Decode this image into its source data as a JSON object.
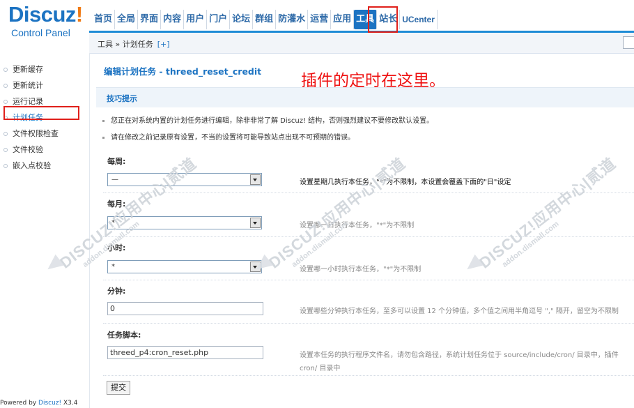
{
  "logo": {
    "brand": "Discuz",
    "bang": "!",
    "sub": "Control Panel"
  },
  "topnav": [
    {
      "label": "首页",
      "active": false
    },
    {
      "label": "全局",
      "active": false
    },
    {
      "label": "界面",
      "active": false
    },
    {
      "label": "内容",
      "active": false
    },
    {
      "label": "用户",
      "active": false
    },
    {
      "label": "门户",
      "active": false
    },
    {
      "label": "论坛",
      "active": false
    },
    {
      "label": "群组",
      "active": false
    },
    {
      "label": "防灌水",
      "active": false
    },
    {
      "label": "运营",
      "active": false
    },
    {
      "label": "应用",
      "active": false
    },
    {
      "label": "工具",
      "active": true
    },
    {
      "label": "站长",
      "active": false
    },
    {
      "label": "UCenter",
      "active": false
    }
  ],
  "breadcrumb": {
    "text": "工具 » 计划任务",
    "add": "[+]"
  },
  "sidebar": {
    "items": [
      "更新缓存",
      "更新统计",
      "运行记录",
      "计划任务",
      "文件权限检查",
      "文件校验",
      "嵌入点校验"
    ],
    "active_index": 3
  },
  "powered": {
    "prefix": "Powered by ",
    "link": "Discuz!",
    "version": " X3.4"
  },
  "page_title": "编辑计划任务 - threed_reset_credit",
  "annotation": "插件的定时在这里。",
  "tips": {
    "heading": "技巧提示",
    "lines": [
      "您正在对系统内置的计划任务进行编辑，除非非常了解 Discuz! 结构，否则强烈建议不要修改默认设置。",
      "请在修改之前记录原有设置，不当的设置将可能导致站点出现不可预期的错误。"
    ]
  },
  "form": {
    "weekly": {
      "label": "每周:",
      "value": "—",
      "desc": "设置星期几执行本任务，\"*\"为不限制，本设置会覆盖下面的\"日\"设定"
    },
    "monthly": {
      "label": "每月:",
      "value": "*",
      "desc": "设置哪一日执行本任务，\"*\"为不限制"
    },
    "hour": {
      "label": "小时:",
      "value": "*",
      "desc": "设置哪一小时执行本任务，\"*\"为不限制"
    },
    "minute": {
      "label": "分钟:",
      "value": "0",
      "desc": "设置哪些分钟执行本任务，至多可以设置 12 个分钟值，多个值之间用半角逗号 \",\" 隔开，留空为不限制"
    },
    "script": {
      "label": "任务脚本:",
      "value": "threed_p4:cron_reset.php",
      "desc1": "设置本任务的执行程序文件名，请勿包含路径，系统计划任务位于 source/include/cron/ 目录中，插件",
      "desc2": "cron/ 目录中"
    },
    "submit": "提交"
  },
  "watermark": {
    "text": "DISCUZ!应用中心|贰道",
    "sub": "addon.dismall.com"
  },
  "colors": {
    "accent": "#1c73c2",
    "highlight": "#e0201b",
    "annotation": "#ee1111"
  }
}
